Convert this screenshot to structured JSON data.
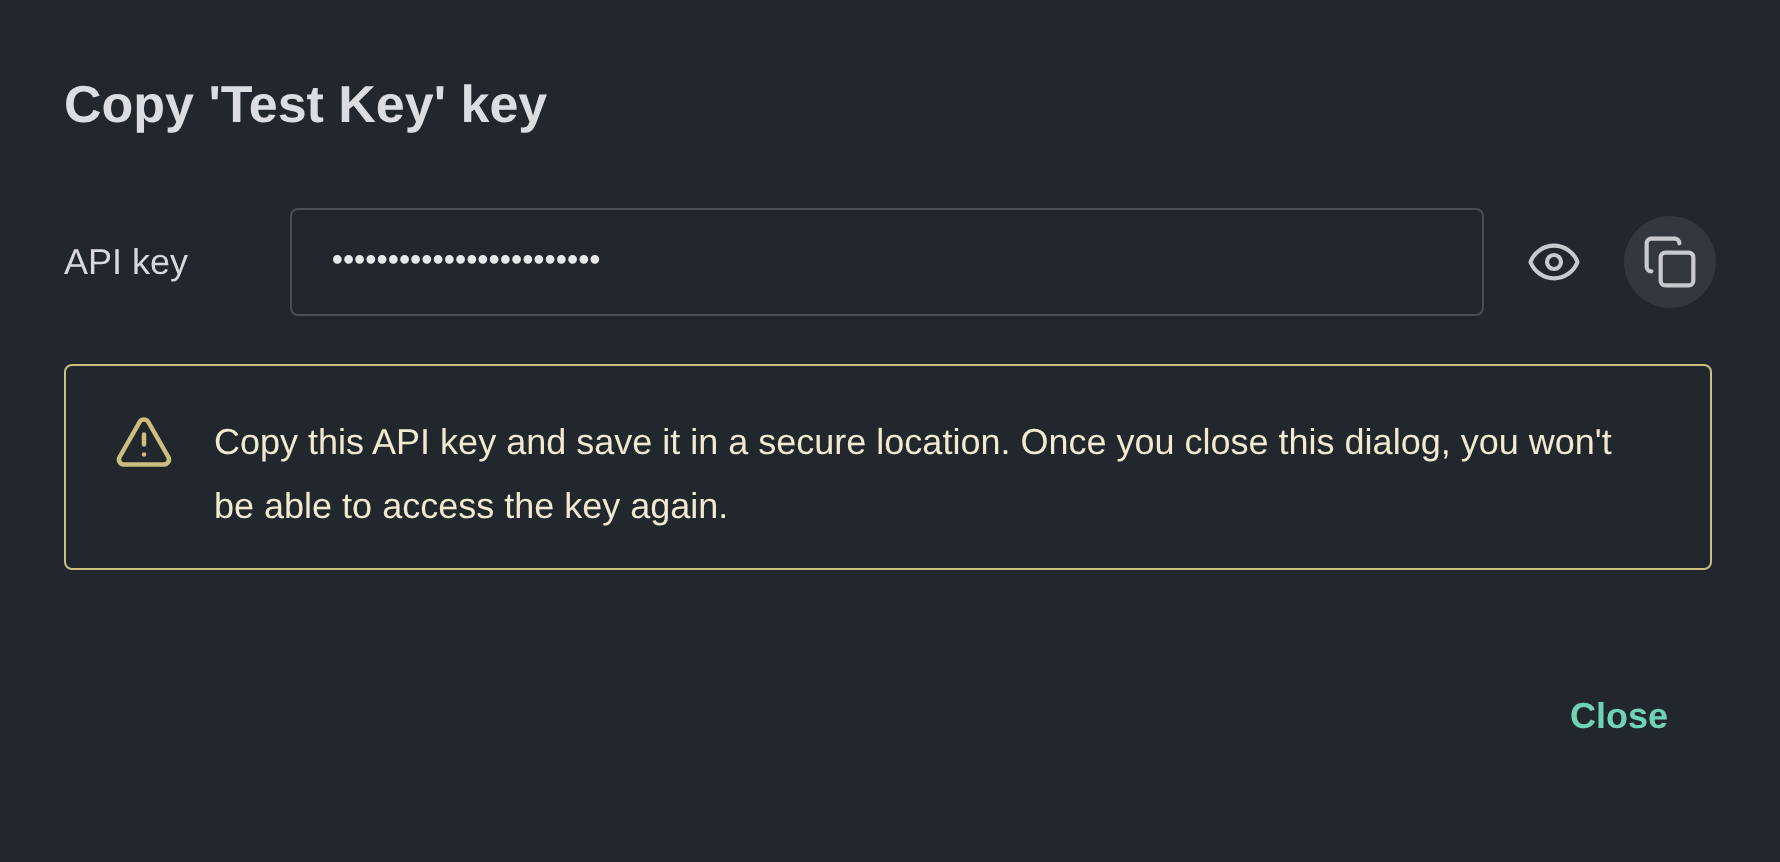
{
  "dialog": {
    "title": "Copy 'Test Key' key",
    "field": {
      "label": "API key",
      "value": "••••••••••••••••••••••••"
    },
    "reveal_button": {
      "hovered": false
    },
    "copy_button": {
      "hovered": true
    },
    "warning": {
      "text": "Copy this API key and save it in a secure location. Once you close this dialog, you won't be able to access the key again."
    },
    "buttons": [
      {
        "label": "Close"
      }
    ]
  }
}
